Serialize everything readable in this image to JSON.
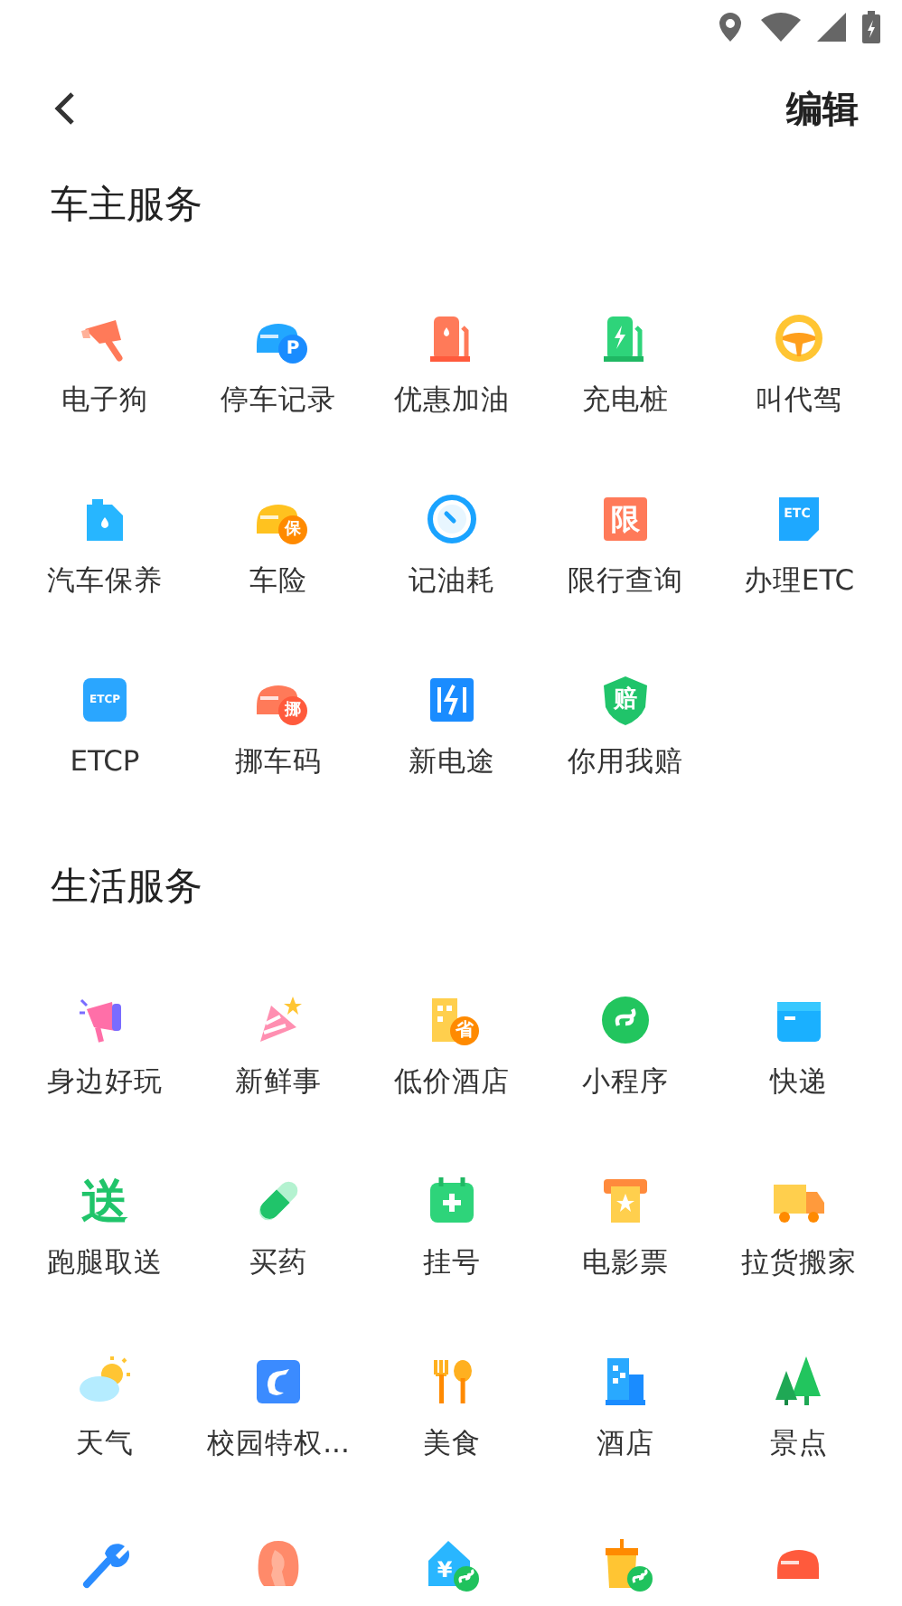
{
  "header": {
    "action": "编辑"
  },
  "sections": [
    {
      "title": "车主服务",
      "items": [
        {
          "label": "电子狗"
        },
        {
          "label": "停车记录",
          "badge": "P"
        },
        {
          "label": "优惠加油"
        },
        {
          "label": "充电桩"
        },
        {
          "label": "叫代驾"
        },
        {
          "label": "汽车保养"
        },
        {
          "label": "车险",
          "badge": "保"
        },
        {
          "label": "记油耗"
        },
        {
          "label": "限行查询",
          "badge": "限"
        },
        {
          "label": "办理ETC",
          "badge": "ETC"
        },
        {
          "label": "ETCP",
          "badge": "ETCP"
        },
        {
          "label": "挪车码",
          "badge": "挪"
        },
        {
          "label": "新电途"
        },
        {
          "label": "你用我赔",
          "badge": "赔"
        }
      ]
    },
    {
      "title": "生活服务",
      "items": [
        {
          "label": "身边好玩"
        },
        {
          "label": "新鲜事"
        },
        {
          "label": "低价酒店",
          "badge": "省"
        },
        {
          "label": "小程序"
        },
        {
          "label": "快递"
        },
        {
          "label": "跑腿取送",
          "badge": "送"
        },
        {
          "label": "买药"
        },
        {
          "label": "挂号"
        },
        {
          "label": "电影票"
        },
        {
          "label": "拉货搬家"
        },
        {
          "label": "天气"
        },
        {
          "label": "校园特权..."
        },
        {
          "label": "美食"
        },
        {
          "label": "酒店"
        },
        {
          "label": "景点"
        },
        {
          "kind": "icon_only"
        },
        {
          "kind": "icon_only"
        },
        {
          "kind": "icon_only",
          "badge": "¥"
        },
        {
          "kind": "icon_only"
        },
        {
          "kind": "icon_only"
        }
      ]
    }
  ]
}
